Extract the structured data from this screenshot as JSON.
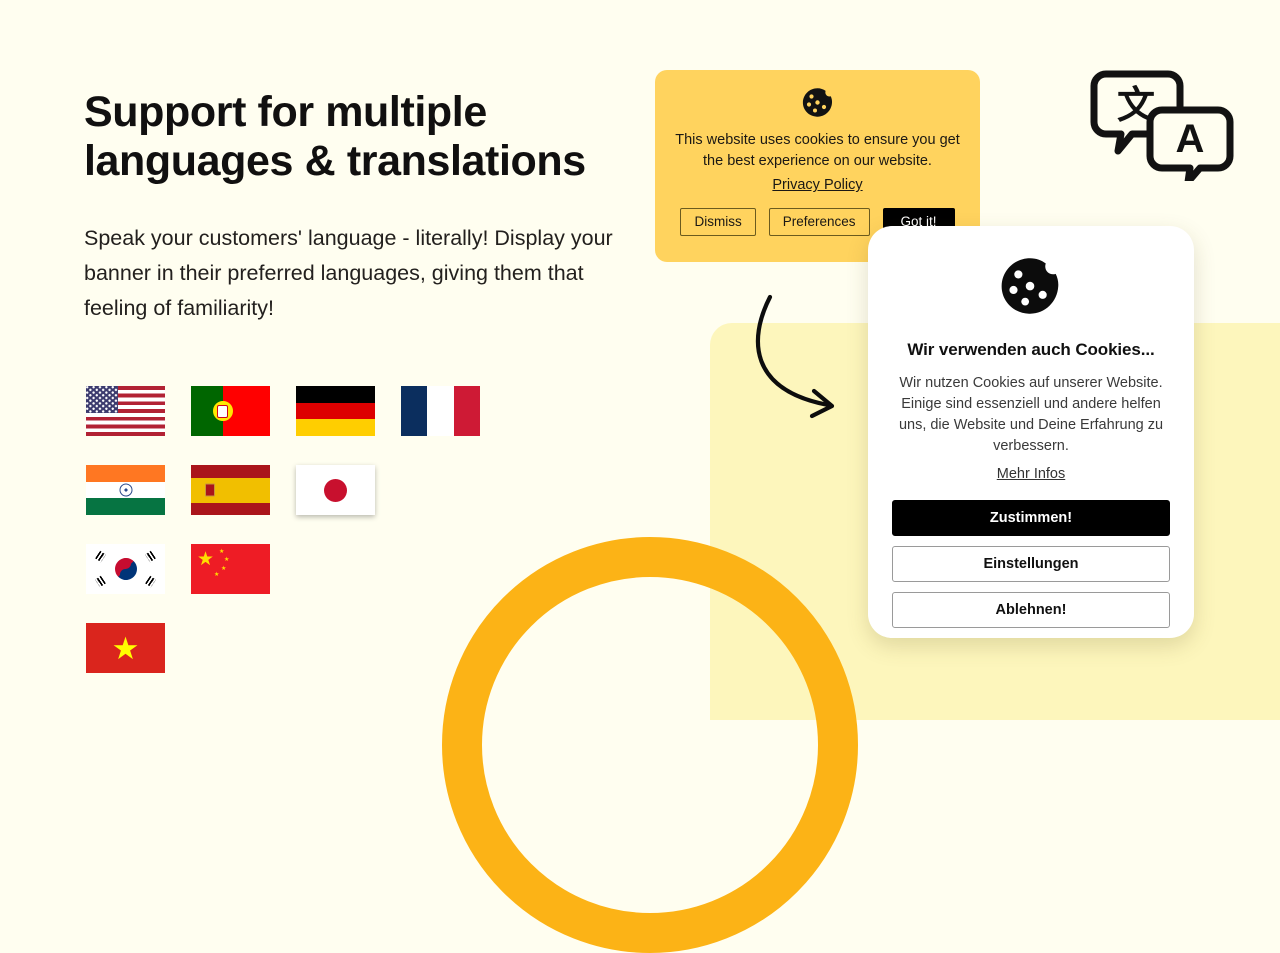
{
  "page": {
    "background_color": "#FFFEF0",
    "accent_yellow": "#FFD35E",
    "pale_yellow": "#FDF6BC",
    "ring_orange": "#FCB316"
  },
  "hero": {
    "headline": "Support for multiple languages & translations",
    "subcopy": "Speak your customers' language - literally! Display your banner in their preferred languages, giving them that feeling of familiarity!"
  },
  "flags": [
    [
      {
        "name": "flag-united-states",
        "label": "United States"
      },
      {
        "name": "flag-portugal",
        "label": "Portugal"
      },
      {
        "name": "flag-germany",
        "label": "Germany"
      },
      {
        "name": "flag-france",
        "label": "France"
      }
    ],
    [
      {
        "name": "flag-india",
        "label": "India"
      },
      {
        "name": "flag-spain",
        "label": "Spain"
      },
      {
        "name": "flag-japan",
        "label": "Japan"
      }
    ],
    [
      {
        "name": "flag-south-korea",
        "label": "South Korea"
      },
      {
        "name": "flag-china",
        "label": "China"
      }
    ],
    [
      {
        "name": "flag-vietnam",
        "label": "Vietnam"
      }
    ]
  ],
  "english_banner": {
    "icon": "cookie-icon",
    "message": "This website uses cookies to ensure you get the best experience on our website.",
    "privacy_link": "Privacy Policy",
    "buttons": [
      {
        "label": "Dismiss",
        "style": "outline"
      },
      {
        "label": "Preferences",
        "style": "outline"
      },
      {
        "label": "Got it!",
        "style": "primary"
      }
    ]
  },
  "german_dialog": {
    "icon": "cookie-icon",
    "title": "Wir verwenden auch Cookies...",
    "body": "Wir nutzen Cookies auf unserer Website. Einige sind essenziell und andere helfen uns, die Website und Deine Erfahrung zu verbessern.",
    "more_link": "Mehr Infos",
    "buttons": [
      {
        "label": "Zustimmen!",
        "style": "accept"
      },
      {
        "label": "Einstellungen",
        "style": "outline"
      },
      {
        "label": "Ablehnen!",
        "style": "outline"
      }
    ]
  },
  "decor": {
    "translate_icon": "translate-icon",
    "translate_glyph_source": "文",
    "translate_glyph_target": "A",
    "arrow_icon": "curved-arrow-icon",
    "ring_icon": "orange-ring-shape"
  }
}
